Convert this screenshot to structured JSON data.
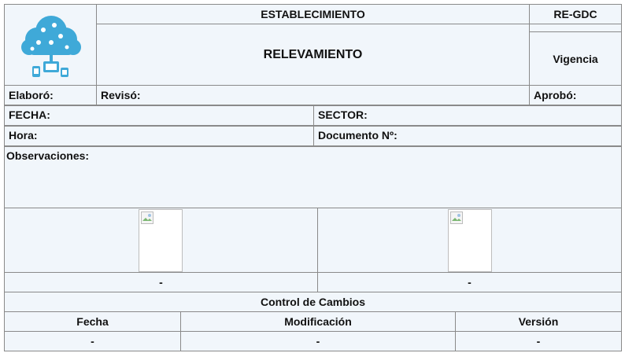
{
  "header": {
    "establecimiento": "ESTABLECIMIENTO",
    "relevamiento": "RELEVAMIENTO",
    "code": "RE-GDC",
    "vigencia": "Vigencia"
  },
  "roles": {
    "elaboro": "Elaboró:",
    "reviso": "Revisó:",
    "aprobo": "Aprobó:"
  },
  "fields": {
    "fecha": "FECHA:",
    "sector": "SECTOR:",
    "hora": "Hora:",
    "documento": "Documento Nº:"
  },
  "observaciones": {
    "label": "Observaciones:"
  },
  "photos": {
    "left_caption": "-",
    "right_caption": "-"
  },
  "changes": {
    "title": "Control de Cambios",
    "headers": [
      "Fecha",
      "Modificación",
      "Versión"
    ],
    "row": [
      "-",
      "-",
      "-"
    ]
  },
  "colors": {
    "logo": "#3fa9d8",
    "cell_bg": "#f1f6fb",
    "border": "#8a8a8a"
  },
  "icons": {
    "logo": "cloud-network-icon"
  }
}
